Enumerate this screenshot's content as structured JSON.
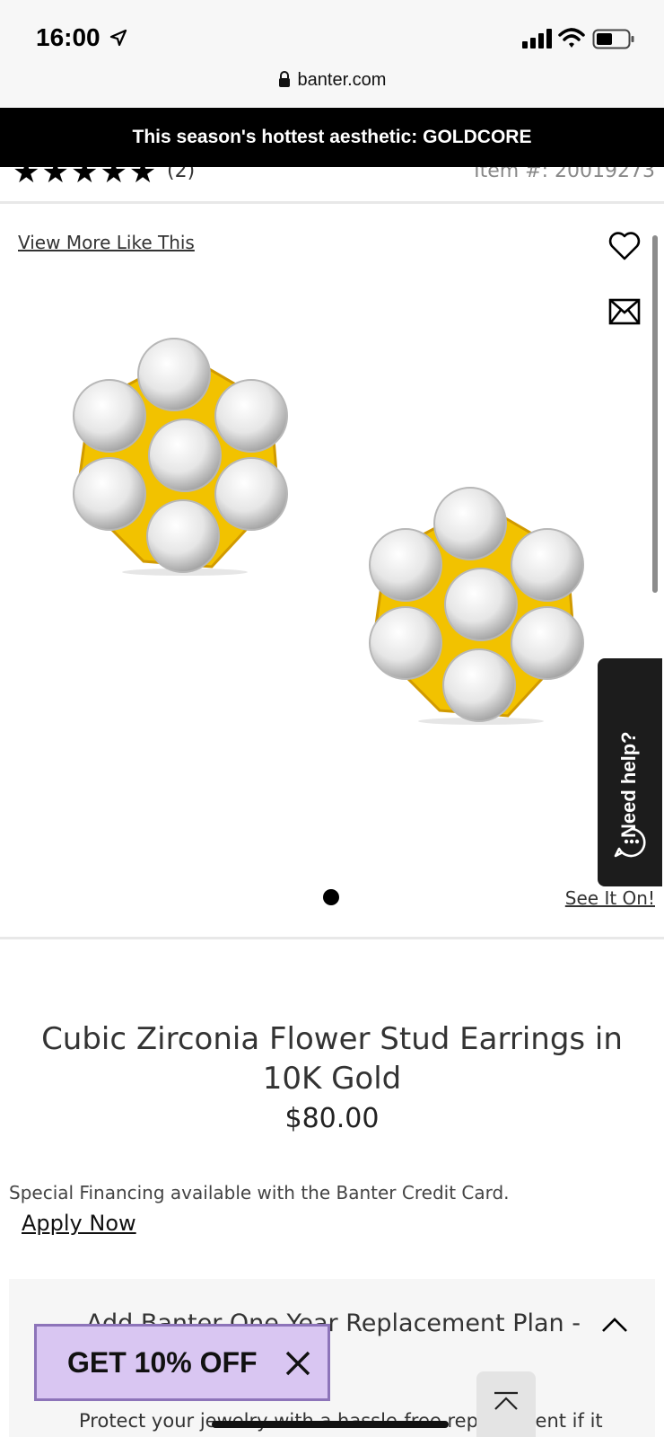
{
  "status_bar": {
    "time": "16:00",
    "url": "banter.com"
  },
  "promo_banner": {
    "text": "This season's hottest aesthetic: GOLDCORE"
  },
  "rating": {
    "count": "(2)",
    "item_number": "Item #: 20019273"
  },
  "gallery": {
    "view_more": "View More Like This",
    "see_it_on": "See It On!",
    "need_help": "Need help?",
    "slide_count": 1
  },
  "product": {
    "title": "Cubic Zirconia Flower Stud Earrings in 10K Gold",
    "price": "$80.00",
    "financing": "Special Financing available with the Banter Credit Card.",
    "apply_now": "Apply Now"
  },
  "replacement_plan": {
    "title": "Add Banter One Year Replacement Plan -",
    "description": "Protect your jewelry with a hassle-free replacement if it"
  },
  "discount_popup": {
    "label": "GET 10% OFF"
  },
  "colors": {
    "promo_bg": "#000000",
    "gold": "#f2c200",
    "popup_bg": "#d9c6f2",
    "popup_border": "#8d74b9",
    "help_bg": "#1c1c1c"
  },
  "icons": [
    "location-arrow-icon",
    "signal-icon",
    "wifi-icon",
    "battery-icon",
    "lock-icon",
    "heart-icon",
    "mail-icon",
    "chat-icon",
    "chevron-up-icon",
    "close-icon",
    "scroll-top-icon"
  ]
}
